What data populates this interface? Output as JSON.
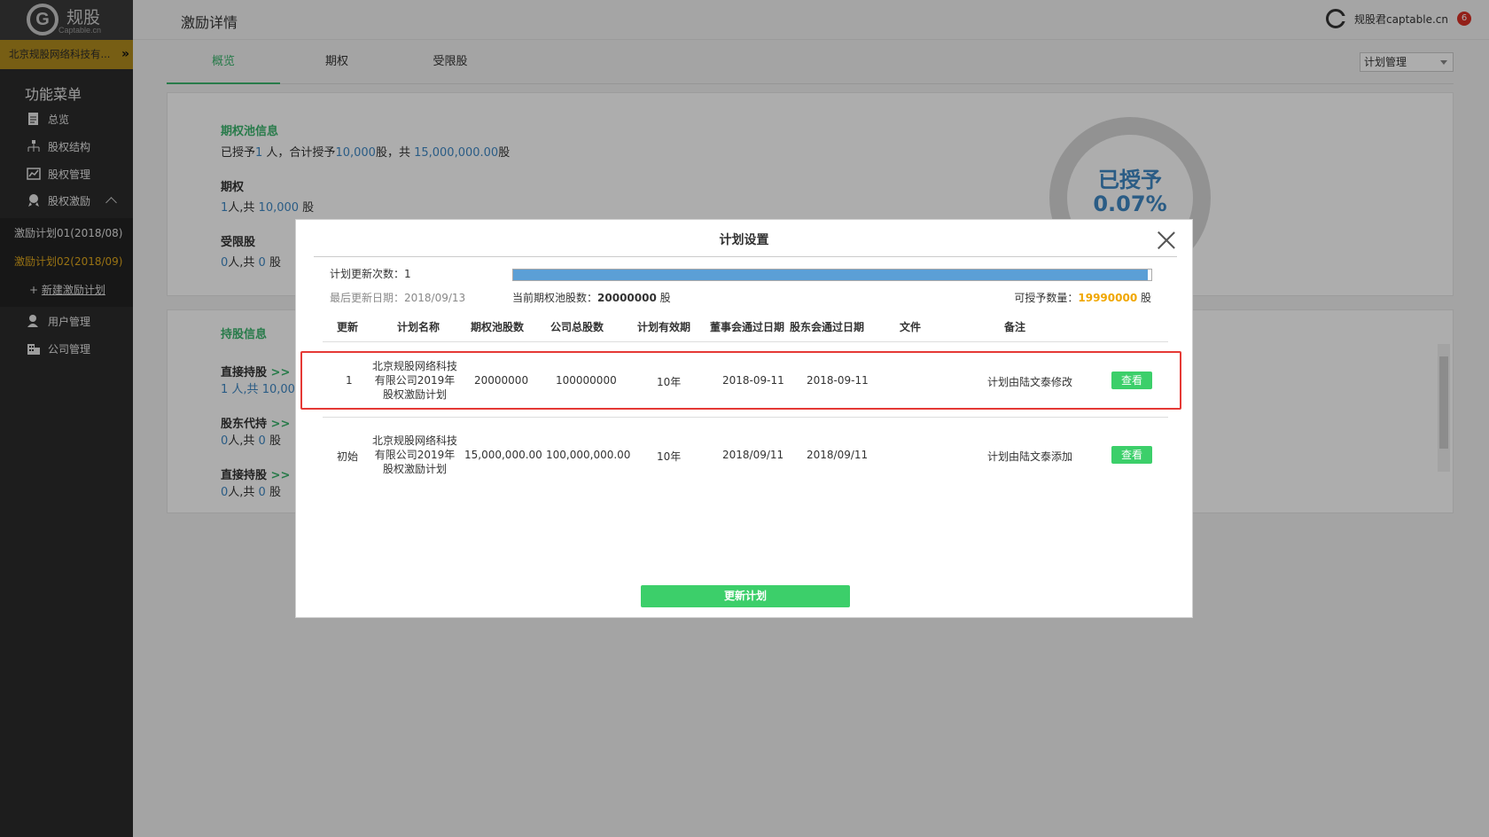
{
  "brand": {
    "name": "规股",
    "sub": "Captable.cn"
  },
  "company": {
    "name": "北京规股网络科技有..."
  },
  "sidebar": {
    "menu_title": "功能菜单",
    "items": [
      {
        "label": "总览",
        "icon": "document-icon"
      },
      {
        "label": "股权结构",
        "icon": "org-chart-icon"
      },
      {
        "label": "股权管理",
        "icon": "chart-icon"
      },
      {
        "label": "股权激励",
        "icon": "award-icon"
      },
      {
        "label": "用户管理",
        "icon": "user-icon"
      },
      {
        "label": "公司管理",
        "icon": "building-icon"
      }
    ],
    "sub_items": [
      {
        "label": "激励计划01(2018/08)"
      },
      {
        "label": "激励计划02(2018/09)"
      }
    ],
    "new_plan": {
      "prefix": "+ ",
      "label": "新建激励计划"
    }
  },
  "header": {
    "title": "激励详情",
    "user": "规股君captable.cn",
    "badge": "6"
  },
  "tabs": [
    {
      "label": "概览"
    },
    {
      "label": "期权"
    },
    {
      "label": "受限股"
    }
  ],
  "plan_select": {
    "value": "计划管理"
  },
  "overview": {
    "pool": {
      "title": "期权池信息",
      "t1": "已授予",
      "v1": "1",
      "t2": " 人，合计授予",
      "v2": "10,000",
      "t3": "股，共 ",
      "v3": "15,000,000.00",
      "t4": "股"
    },
    "option": {
      "label": "期权",
      "people": "1",
      "mid": "人,共 ",
      "shares": "10,000",
      "unit": " 股"
    },
    "restricted": {
      "label": "受限股",
      "people": "0",
      "mid": "人,共 ",
      "shares": "0",
      "unit": " 股"
    },
    "ring": {
      "line1": "已授予",
      "line2": "0.07%"
    }
  },
  "holdings": {
    "title": "持股信息",
    "rows": [
      {
        "label": "直接持股",
        "arrow": ">>",
        "people": "1",
        "mid": " 人,共 ",
        "shares": "10,00"
      },
      {
        "label": "股东代持",
        "arrow": ">>",
        "people": "0",
        "mid": "人,共 ",
        "shares": "0",
        "unit": " 股"
      },
      {
        "label": "直接持股",
        "arrow": ">>",
        "people": "0",
        "mid": "人,共 ",
        "shares": "0",
        "unit": " 股"
      }
    ]
  },
  "modal": {
    "title": "计划设置",
    "update_count_label": "计划更新次数：",
    "update_count": "1",
    "last_date_label": "最后更新日期：",
    "last_date": "2018/09/13",
    "pool_label": "当前期权池股数：",
    "pool_value": "20000000",
    "pool_unit": " 股",
    "grantable_label": "可授予数量：",
    "grantable_value": "19990000",
    "grantable_unit": " 股",
    "progress": 0.995,
    "columns": [
      "更新",
      "计划名称",
      "期权池股数",
      "公司总股数",
      "计划有效期",
      "董事会通过日期",
      "股东会通过日期",
      "文件",
      "备注"
    ],
    "rows": [
      {
        "update": "1",
        "name": "北京规股网络科技有限公司2019年股权激励计划",
        "pool": "20000000",
        "total": "100000000",
        "validity": "10年",
        "board": "2018-09-11",
        "shareholder": "2018-09-11",
        "file": "",
        "note": "计划由陆文泰修改",
        "action": "查看"
      },
      {
        "update": "初始",
        "name": "北京规股网络科技有限公司2019年股权激励计划",
        "pool": "15,000,000.00",
        "total": "100,000,000.00",
        "validity": "10年",
        "board": "2018/09/11",
        "shareholder": "2018/09/11",
        "file": "",
        "note": "计划由陆文泰添加",
        "action": "查看"
      }
    ],
    "update_button": "更新计划"
  },
  "colors": {
    "accent": "#3bb56e",
    "button": "#3ccf6a",
    "highlight": "#e53935",
    "gold": "#b08b1e"
  }
}
